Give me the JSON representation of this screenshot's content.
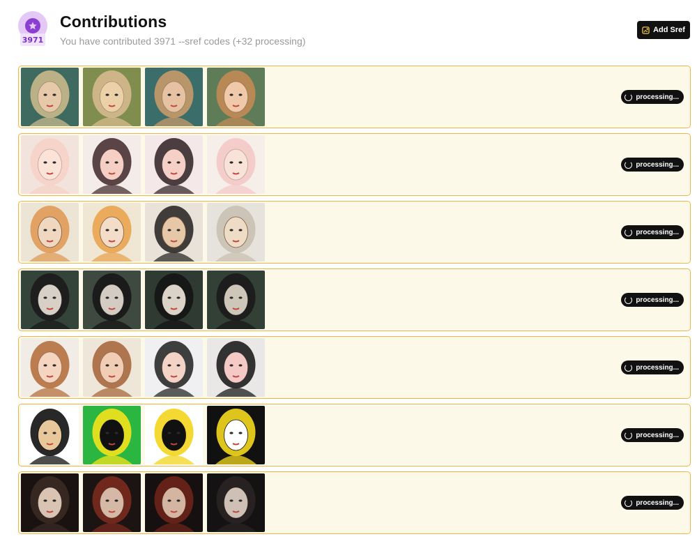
{
  "header": {
    "badge_count": "3971",
    "title": "Contributions",
    "subtitle": "You have contributed 3971 --sref codes (+32 processing)",
    "add_button_label": "Add Sref",
    "badge_icon": "star-icon",
    "add_icon": "image-plus-icon"
  },
  "colors": {
    "badge_bg": "#e4c9f6",
    "badge_accent": "#8b3fd1",
    "row_bg": "#fdf9e8",
    "row_border": "#f0b54a",
    "button_bg": "#111111"
  },
  "rows": [
    {
      "status": "processing...",
      "style": "ornate-teal-portraits",
      "palette": [
        [
          "#3e6a60",
          "#c9b98c",
          "#e6c9a8"
        ],
        [
          "#7f8e4f",
          "#d7b98e",
          "#ecd0a8"
        ],
        [
          "#3b6d6a",
          "#c79a6a",
          "#e7c2a2"
        ],
        [
          "#5f7c58",
          "#c28a55",
          "#f0c9aa"
        ]
      ]
    },
    {
      "status": "processing...",
      "style": "soft-pastel-faces",
      "palette": [
        [
          "#f2e4dc",
          "#f6d2c6",
          "#fbe3d8"
        ],
        [
          "#f3ece8",
          "#4a3233",
          "#f5cfc4"
        ],
        [
          "#f4e9e8",
          "#3a2a2e",
          "#f6d0c6"
        ],
        [
          "#f6efe9",
          "#f4c9c8",
          "#f9e2d8"
        ]
      ]
    },
    {
      "status": "processing...",
      "style": "line-art-sketch",
      "palette": [
        [
          "#ece5d6",
          "#e09a56",
          "#f0d8c0"
        ],
        [
          "#efe6d4",
          "#e9a450",
          "#f3ddc8"
        ],
        [
          "#e8e2d8",
          "#2e2a28",
          "#e6c8a8"
        ],
        [
          "#e6e3dc",
          "#c9c0b2",
          "#efdcc6"
        ]
      ]
    },
    {
      "status": "processing...",
      "style": "dark-green-gothic",
      "palette": [
        [
          "#34443a",
          "#1b1b1b",
          "#d8d0c6"
        ],
        [
          "#3e4a3f",
          "#161616",
          "#d4ccc2"
        ],
        [
          "#2f3a32",
          "#141414",
          "#dcd3c8"
        ],
        [
          "#334035",
          "#1a1a1a",
          "#cfc6ba"
        ]
      ]
    },
    {
      "status": "processing...",
      "style": "colored-pencil-kids",
      "palette": [
        [
          "#f1ece6",
          "#b5703f",
          "#f5d4c0"
        ],
        [
          "#efe6da",
          "#a7683e",
          "#f2cdb6"
        ],
        [
          "#f0eff1",
          "#2a2a2a",
          "#f3d3c6"
        ],
        [
          "#eae8e6",
          "#1e1e1e",
          "#f4c9c6"
        ]
      ]
    },
    {
      "status": "processing...",
      "style": "pop-art-bold",
      "palette": [
        [
          "#ffffff",
          "#111111",
          "#e8c79a"
        ],
        [
          "#2ab640",
          "#f4e31c",
          "#111111"
        ],
        [
          "#ffffff",
          "#f2d51c",
          "#111111"
        ],
        [
          "#111111",
          "#f5d91d",
          "#ffffff"
        ]
      ]
    },
    {
      "status": "processing...",
      "style": "dark-vintage-portraits",
      "palette": [
        [
          "#1a1210",
          "#3a2a24",
          "#d9c4b4"
        ],
        [
          "#1c1412",
          "#7a2a1e",
          "#d6b8a6"
        ],
        [
          "#161110",
          "#6b241a",
          "#d3b5a2"
        ],
        [
          "#141212",
          "#2a2424",
          "#cfc0b6"
        ]
      ]
    }
  ]
}
